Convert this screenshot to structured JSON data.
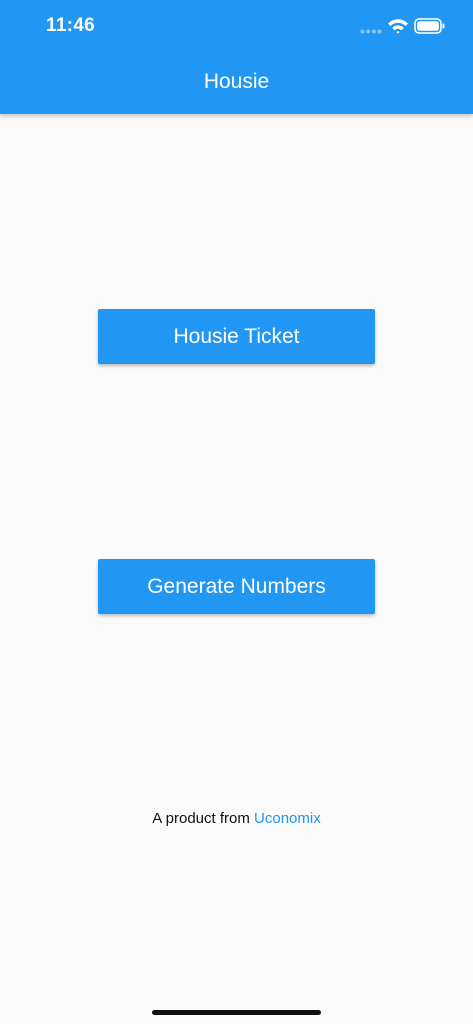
{
  "status_bar": {
    "time": "11:46",
    "icons": [
      "signal-dots-icon",
      "wifi-icon",
      "battery-icon"
    ]
  },
  "app_bar": {
    "title": "Housie",
    "color": "#2196f3"
  },
  "main": {
    "buttons": [
      {
        "label": "Housie Ticket"
      },
      {
        "label": "Generate Numbers"
      }
    ]
  },
  "footer": {
    "prefix": "A product from ",
    "link_text": "Uconomix",
    "link_color": "#2196f3"
  },
  "colors": {
    "primary": "#2196f3",
    "background": "#fafafa",
    "text": "#111111"
  }
}
